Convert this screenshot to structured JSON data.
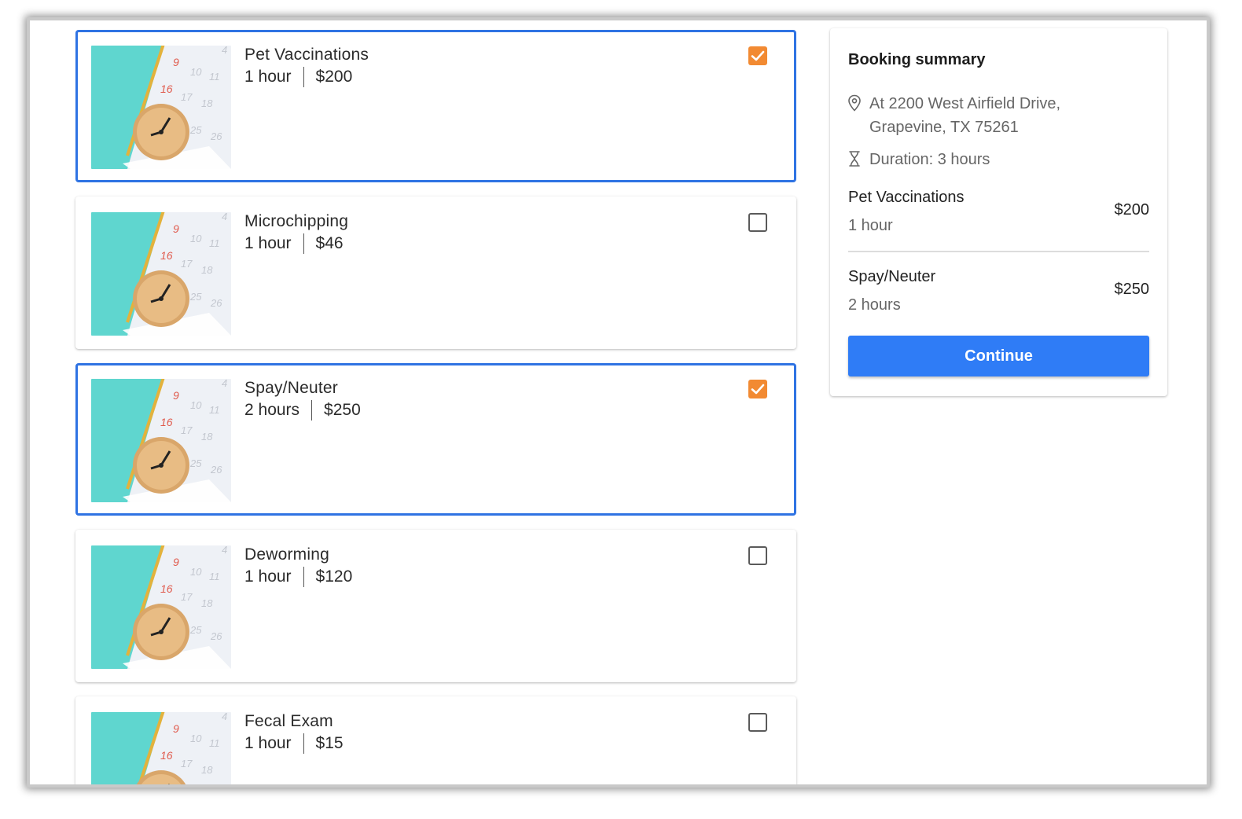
{
  "services": [
    {
      "name": "Pet Vaccinations",
      "duration": "1 hour",
      "price": "$200",
      "selected": true
    },
    {
      "name": "Microchipping",
      "duration": "1 hour",
      "price": "$46",
      "selected": false
    },
    {
      "name": "Spay/Neuter",
      "duration": "2 hours",
      "price": "$250",
      "selected": true
    },
    {
      "name": "Deworming",
      "duration": "1 hour",
      "price": "$120",
      "selected": false
    },
    {
      "name": "Fecal Exam",
      "duration": "1 hour",
      "price": "$15",
      "selected": false
    }
  ],
  "summary": {
    "title": "Booking summary",
    "address_line1": "At 2200 West Airfield Drive,",
    "address_line2": "Grapevine, TX 75261",
    "duration": "Duration: 3 hours",
    "items": [
      {
        "name": "Pet Vaccinations",
        "duration": "1 hour",
        "price": "$200"
      },
      {
        "name": "Spay/Neuter",
        "duration": "2 hours",
        "price": "$250"
      }
    ],
    "continue_label": "Continue"
  },
  "colors": {
    "accent": "#2f7cf6",
    "selected_border": "#2f73e3",
    "checkbox_checked": "#f28a32"
  },
  "icons": {
    "location": "location-pin-icon",
    "duration": "hourglass-icon",
    "checkbox": "checkmark-icon"
  }
}
